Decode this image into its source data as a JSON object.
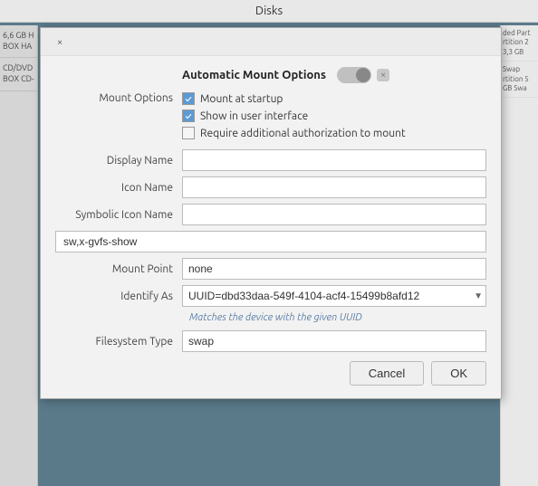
{
  "titleBar": {
    "label": "Disks"
  },
  "sidebar": {
    "items": [
      {
        "line1": "6,6 GB H",
        "line2": "BOX HA"
      },
      {
        "line1": "CD/DVD",
        "line2": "BOX CD-"
      }
    ]
  },
  "rightPanel": {
    "items": [
      {
        "line1": "ded Part",
        "line2": "rtition 2",
        "line3": "3,3 GB"
      },
      {
        "line1": "Swap",
        "line2": "rtition 5",
        "line3": "GB Swa"
      }
    ]
  },
  "dialog": {
    "closeBtn": "×",
    "title": "Automatic Mount Options",
    "toggleLabel": "×",
    "mountOptions": {
      "label": "Mount Options",
      "checkboxes": [
        {
          "id": "mount-startup",
          "label": "Mount at startup",
          "checked": true
        },
        {
          "id": "show-ui",
          "label": "Show in user interface",
          "checked": true
        },
        {
          "id": "require-auth",
          "label": "Require additional authorization to mount",
          "checked": false
        }
      ]
    },
    "fields": [
      {
        "id": "display-name",
        "label": "Display Name",
        "value": ""
      },
      {
        "id": "icon-name",
        "label": "Icon Name",
        "value": ""
      },
      {
        "id": "symbolic-icon-name",
        "label": "Symbolic Icon Name",
        "value": ""
      }
    ],
    "optionsValue": "sw,x-gvfs-show",
    "mountPoint": {
      "label": "Mount Point",
      "value": "none"
    },
    "identifyAs": {
      "label": "Identify As",
      "value": "UUID=dbd33daa-549f-4104-acf4-15499b8afd12",
      "options": [
        "UUID=dbd33daa-549f-4104-acf4-15499b8afd12"
      ],
      "helperText": "Matches the device with the given UUID"
    },
    "filesystemType": {
      "label": "Filesystem Type",
      "value": "swap"
    },
    "buttons": {
      "cancel": "Cancel",
      "ok": "OK"
    }
  }
}
